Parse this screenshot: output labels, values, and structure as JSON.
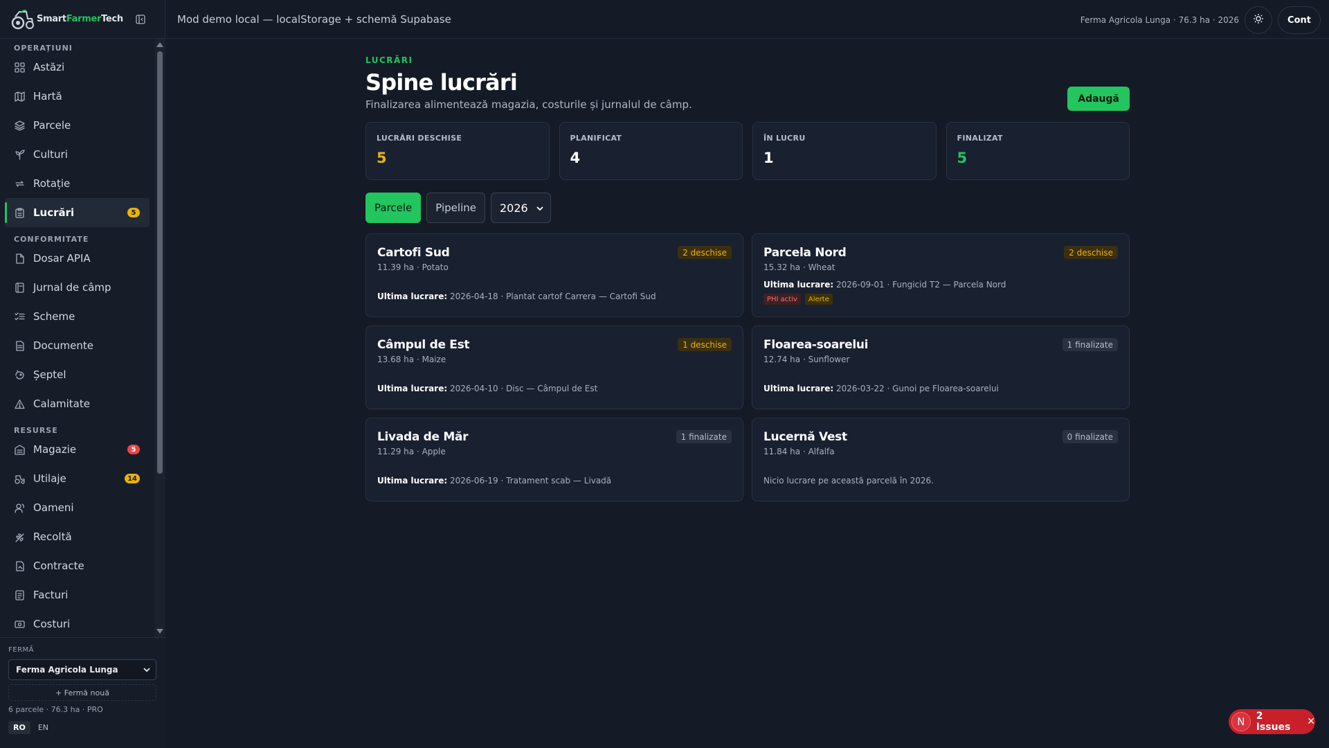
{
  "brand": {
    "name_a": "Smart",
    "name_b": "Farmer",
    "name_c": "Tech"
  },
  "topbar": {
    "message": "Mod demo local — localStorage + schemă Supabase",
    "farm_meta": "Ferma Agricola Lunga · 76.3 ha · 2026",
    "account_label": "Cont"
  },
  "sidebar": {
    "sections": [
      {
        "title": "OPERAȚIUNI",
        "items": [
          {
            "label": "Astăzi",
            "icon": "dashboard-icon"
          },
          {
            "label": "Hartă",
            "icon": "map-icon"
          },
          {
            "label": "Parcele",
            "icon": "layers-icon"
          },
          {
            "label": "Culturi",
            "icon": "sprout-icon"
          },
          {
            "label": "Rotație",
            "icon": "repeat-icon"
          },
          {
            "label": "Lucrări",
            "icon": "clipboard-icon",
            "badge": "5",
            "active": true
          }
        ]
      },
      {
        "title": "CONFORMITATE",
        "items": [
          {
            "label": "Dosar APIA",
            "icon": "file-icon"
          },
          {
            "label": "Jurnal de câmp",
            "icon": "notebook-icon"
          },
          {
            "label": "Scheme",
            "icon": "list-check-icon"
          },
          {
            "label": "Documente",
            "icon": "document-icon"
          },
          {
            "label": "Șeptel",
            "icon": "animal-icon"
          },
          {
            "label": "Calamitate",
            "icon": "warning-icon"
          }
        ]
      },
      {
        "title": "RESURSE",
        "items": [
          {
            "label": "Magazie",
            "icon": "warehouse-icon",
            "badge": "5",
            "badge_color": "red"
          },
          {
            "label": "Utilaje",
            "icon": "tractor-icon",
            "badge": "14"
          },
          {
            "label": "Oameni",
            "icon": "users-icon"
          },
          {
            "label": "Recoltă",
            "icon": "wheat-icon"
          },
          {
            "label": "Contracte",
            "icon": "contract-icon"
          },
          {
            "label": "Facturi",
            "icon": "invoice-icon"
          },
          {
            "label": "Costuri",
            "icon": "cost-icon"
          }
        ]
      }
    ],
    "farm": {
      "label": "FERMĂ",
      "selected": "Ferma Agricola Lunga",
      "new_farm": "+ Fermă nouă",
      "info": "6 parcele · 76.3 ha · PRO",
      "lang_ro": "RO",
      "lang_en": "EN"
    }
  },
  "page": {
    "eyebrow": "LUCRĂRI",
    "title": "Spine lucrări",
    "subtitle": "Finalizarea alimentează magazia, costurile și jurnalul de câmp.",
    "add_label": "Adaugă"
  },
  "stats": [
    {
      "label": "LUCRĂRI DESCHISE",
      "value": "5",
      "color": "#eab308"
    },
    {
      "label": "PLANIFICAT",
      "value": "4",
      "color": "#ffffff"
    },
    {
      "label": "ÎN LUCRU",
      "value": "1",
      "color": "#ffffff"
    },
    {
      "label": "FINALIZAT",
      "value": "5",
      "color": "#22c55e"
    }
  ],
  "toolbar": {
    "tab_parcels": "Parcele",
    "tab_pipeline": "Pipeline",
    "year": "2026"
  },
  "cards": [
    {
      "title": "Cartofi Sud",
      "sub": "11.39 ha · Potato",
      "tag": "2 deschise",
      "tag_type": "open",
      "last_label": "Ultima lucrare:",
      "last_value": " 2026-04-18 · Plantat cartof Carrera — Cartofi Sud"
    },
    {
      "title": "Parcela Nord",
      "sub": "15.32 ha · Wheat",
      "tag": "2 deschise",
      "tag_type": "open",
      "last_label": "Ultima lucrare:",
      "last_value": " 2026-09-01 · Fungicid T2 — Parcela Nord",
      "mini_tags": [
        "PHI activ",
        "Alerte"
      ]
    },
    {
      "title": "Câmpul de Est",
      "sub": "13.68 ha · Maize",
      "tag": "1 deschise",
      "tag_type": "open",
      "last_label": "Ultima lucrare:",
      "last_value": " 2026-04-10 · Disc — Câmpul de Est"
    },
    {
      "title": "Floarea-soarelui",
      "sub": "12.74 ha · Sunflower",
      "tag": "1 finalizate",
      "tag_type": "done",
      "last_label": "Ultima lucrare:",
      "last_value": " 2026-03-22 · Gunoi pe Floarea-soarelui"
    },
    {
      "title": "Livada de Măr",
      "sub": "11.29 ha · Apple",
      "tag": "1 finalizate",
      "tag_type": "done",
      "last_label": "Ultima lucrare:",
      "last_value": " 2026-06-19 · Tratament scab — Livadă"
    },
    {
      "title": "Lucernă Vest",
      "sub": "11.84 ha · Alfalfa",
      "tag": "0 finalizate",
      "tag_type": "done",
      "last_label": "",
      "last_value": "Nicio lucrare pe această parcelă în 2026."
    }
  ],
  "issues": {
    "letter": "N",
    "label": "2 Issues"
  }
}
